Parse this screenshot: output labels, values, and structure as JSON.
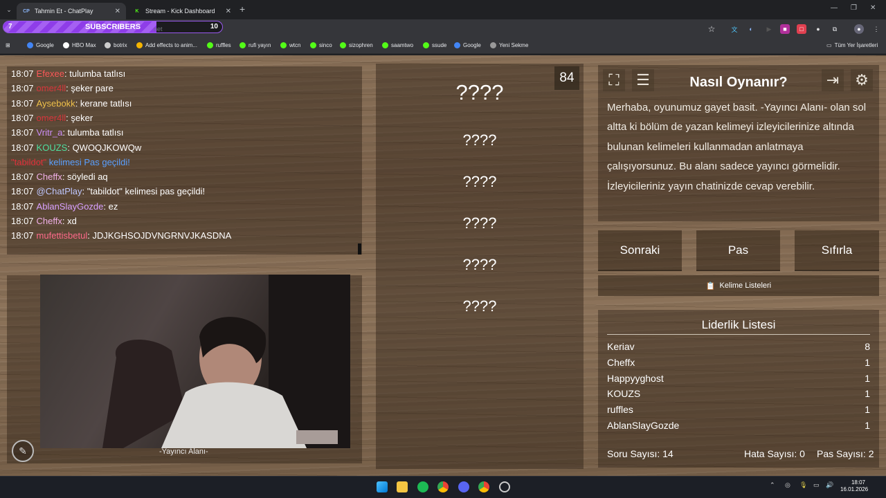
{
  "browser": {
    "tabs": [
      {
        "label": "Tahmin Et - ChatPlay",
        "favicon": "CP"
      },
      {
        "label": "Stream - Kick Dashboard",
        "favicon": "K"
      }
    ],
    "subs_goal": {
      "left": "7",
      "label": "SUBSCRIBERS",
      "right": "10",
      "progress": 0.7
    },
    "url_ghost": "net",
    "bookmarks": [
      "Google",
      "HBO Max",
      "botrix",
      "Add effects to anim...",
      "ruffles",
      "rufi yayın",
      "wtcn",
      "sinco",
      "sizophren",
      "saamtwo",
      "ssude",
      "Google",
      "Yeni Sekme"
    ],
    "all_bookmarks": "Tüm Yer İşaretleri"
  },
  "chat": {
    "messages": [
      {
        "time": "18:07",
        "user": "Efexee",
        "color": "#ff5a5a",
        "text": ": tulumba tatlısı"
      },
      {
        "time": "18:07",
        "user": "omer4ll",
        "color": "#d6343a",
        "text": ": şeker pare"
      },
      {
        "time": "18:07",
        "user": "Aysebokk",
        "color": "#f0c24b",
        "text": ": kerane tatlısı"
      },
      {
        "time": "18:07",
        "user": "omer4ll",
        "color": "#d6343a",
        "text": ": şeker"
      },
      {
        "time": "18:07",
        "user": "Vritr_a",
        "color": "#c88cf5",
        "text": ": tulumba tatlısı"
      },
      {
        "time": "18:07",
        "user": "KOUZS",
        "color": "#4fe0a0",
        "text": ": QWOQJKOWQw"
      },
      {
        "time": "",
        "user": "\"tabildot\"",
        "color": "#e0303a",
        "text": " kelimesi Pas geçildi!",
        "system": true
      },
      {
        "time": "18:07",
        "user": "Cheffx",
        "color": "#f0b0e8",
        "text": ": söyledi aq"
      },
      {
        "time": "18:07",
        "user": "@ChatPlay",
        "color": "#c0c8ff",
        "text": ": \"tabildot\" kelimesi pas geçildi!"
      },
      {
        "time": "18:07",
        "user": "AblanSlayGozde",
        "color": "#d8a0ff",
        "text": ": ez"
      },
      {
        "time": "18:07",
        "user": "Cheffx",
        "color": "#f0b0e8",
        "text": ": xd"
      },
      {
        "time": "18:07",
        "user": "mufettisbetul",
        "color": "#ff6a8a",
        "text": ": JDJKGHSOJDVNGRNVJKASDNA"
      }
    ]
  },
  "camera": {
    "label": "-Yayıncı Alanı-"
  },
  "words": [
    "????",
    "????",
    "????",
    "????",
    "????",
    "????"
  ],
  "timer": "84",
  "howto": {
    "title": "Nasıl Oynanır?",
    "text": "Merhaba, oyunumuz gayet basit. -Yayıncı Alanı- olan sol altta ki bölüm de yazan kelimeyi izleyicilerinize altında bulunan kelimeleri kullanmadan anlatmaya çalışıyorsunuz. Bu alanı sadece yayıncı görmelidir. İzleyicileriniz yayın chatinizde cevap verebilir."
  },
  "actions": {
    "next": "Sonraki",
    "pass": "Pas",
    "reset": "Sıfırla",
    "word_lists": "Kelime Listeleri"
  },
  "leaderboard": {
    "title": "Liderlik Listesi",
    "rows": [
      {
        "name": "Keriav",
        "score": "8"
      },
      {
        "name": "Cheffx",
        "score": "1"
      },
      {
        "name": "Happyyghost",
        "score": "1"
      },
      {
        "name": "KOUZS",
        "score": "1"
      },
      {
        "name": "ruffles",
        "score": "1"
      },
      {
        "name": "AblanSlayGozde",
        "score": "1"
      }
    ]
  },
  "stats": {
    "questions": "Soru Sayısı: 14",
    "errors": "Hata Sayısı: 0",
    "passes": "Pas Sayısı: 2"
  },
  "taskbar": {
    "time": "18:07",
    "date": "16.01.2026"
  }
}
